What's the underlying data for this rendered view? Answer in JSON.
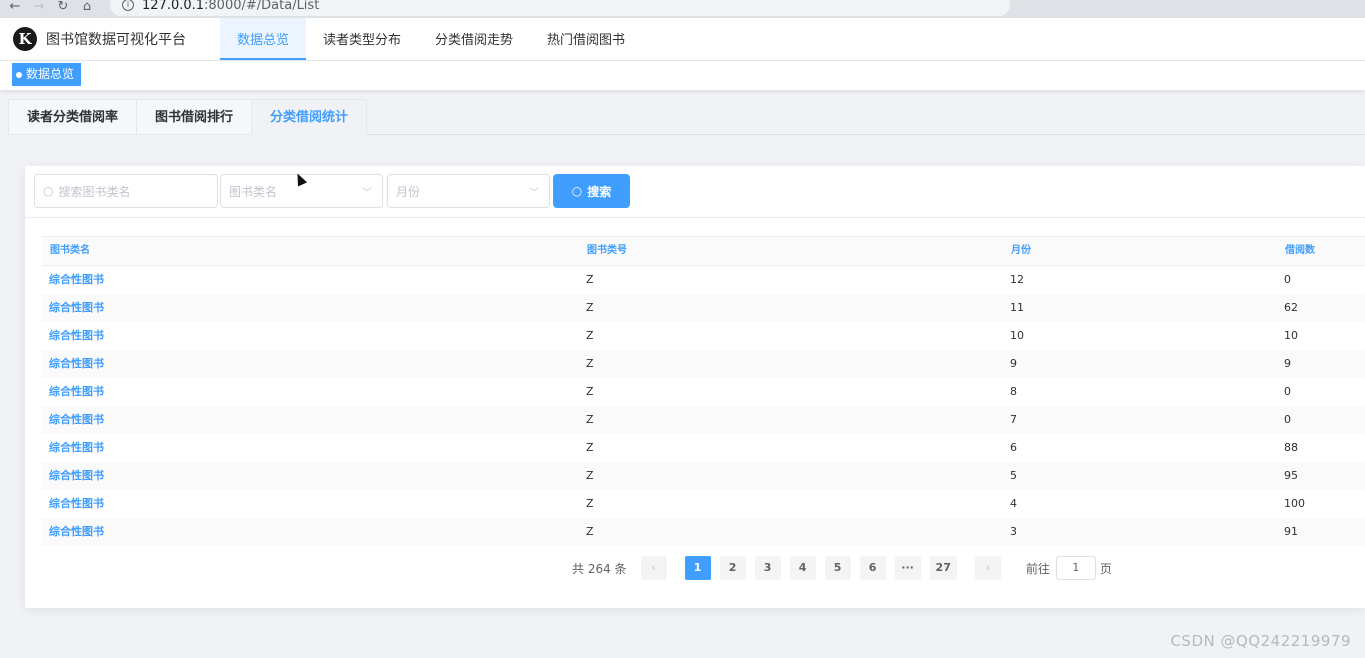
{
  "browser": {
    "url_host": "127.0.0.1",
    "url_path": ":8000/#/Data/List"
  },
  "header": {
    "title": "图书馆数据可视化平台",
    "logo_letter": "K",
    "menu": [
      {
        "label": "数据总览",
        "active": true
      },
      {
        "label": "读者类型分布"
      },
      {
        "label": "分类借阅走势"
      },
      {
        "label": "热门借阅图书"
      }
    ]
  },
  "tag": {
    "label": "数据总览"
  },
  "subtabs": [
    {
      "label": "读者分类借阅率"
    },
    {
      "label": "图书借阅排行"
    },
    {
      "label": "分类借阅统计",
      "active": true
    }
  ],
  "search": {
    "input_placeholder": "搜索图书类名",
    "category_placeholder": "图书类名",
    "month_placeholder": "月份",
    "button_label": "搜索"
  },
  "table": {
    "headers": [
      "图书类名",
      "图书类号",
      "月份",
      "借阅数"
    ],
    "rows": [
      [
        "综合性图书",
        "Z",
        "12",
        "0"
      ],
      [
        "综合性图书",
        "Z",
        "11",
        "62"
      ],
      [
        "综合性图书",
        "Z",
        "10",
        "10"
      ],
      [
        "综合性图书",
        "Z",
        "9",
        "9"
      ],
      [
        "综合性图书",
        "Z",
        "8",
        "0"
      ],
      [
        "综合性图书",
        "Z",
        "7",
        "0"
      ],
      [
        "综合性图书",
        "Z",
        "6",
        "88"
      ],
      [
        "综合性图书",
        "Z",
        "5",
        "95"
      ],
      [
        "综合性图书",
        "Z",
        "4",
        "100"
      ],
      [
        "综合性图书",
        "Z",
        "3",
        "91"
      ]
    ]
  },
  "pagination": {
    "total_text": "共 264 条",
    "pages": [
      "1",
      "2",
      "3",
      "4",
      "5",
      "6",
      "···",
      "27"
    ],
    "current": "1",
    "goto_prefix": "前往",
    "goto_value": "1",
    "goto_suffix": "页"
  },
  "watermark": "CSDN @QQ242219979",
  "colors": {
    "accent": "#409eff",
    "background": "#f0f2f5"
  }
}
